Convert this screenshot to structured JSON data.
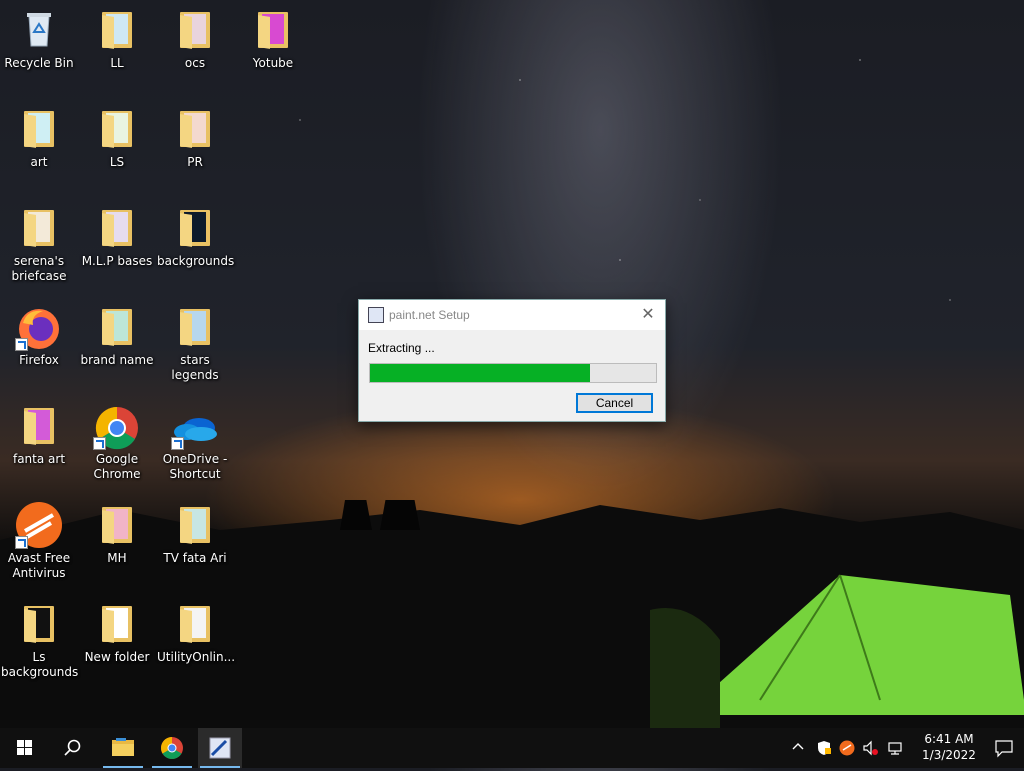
{
  "desktop": {
    "icons": [
      {
        "label": "Recycle Bin",
        "type": "recycle-bin"
      },
      {
        "label": "LL",
        "type": "folder"
      },
      {
        "label": "ocs",
        "type": "folder"
      },
      {
        "label": "Yotube",
        "type": "folder"
      },
      {
        "label": "art",
        "type": "folder"
      },
      {
        "label": "LS",
        "type": "folder"
      },
      {
        "label": "PR",
        "type": "folder"
      },
      {
        "label": "serena's briefcase",
        "type": "folder"
      },
      {
        "label": "M.L.P bases",
        "type": "folder"
      },
      {
        "label": "backgrounds",
        "type": "folder"
      },
      {
        "label": "Firefox",
        "type": "firefox-shortcut"
      },
      {
        "label": "brand name",
        "type": "folder"
      },
      {
        "label": "stars legends",
        "type": "folder"
      },
      {
        "label": "fanta art",
        "type": "folder"
      },
      {
        "label": "Google Chrome",
        "type": "chrome-shortcut"
      },
      {
        "label": "OneDrive - Shortcut",
        "type": "onedrive-shortcut"
      },
      {
        "label": "Avast Free Antivirus",
        "type": "avast-shortcut"
      },
      {
        "label": "MH",
        "type": "folder"
      },
      {
        "label": "TV fata Ari",
        "type": "folder"
      },
      {
        "label": "Ls backgrounds",
        "type": "folder"
      },
      {
        "label": "New folder",
        "type": "folder"
      },
      {
        "label": "UtilityOnlin...",
        "type": "folder"
      }
    ]
  },
  "dialog": {
    "title": "paint.net Setup",
    "status": "Extracting ...",
    "progress_fraction": 0.77,
    "cancel_label": "Cancel",
    "close_glyph": "✕"
  },
  "taskbar": {
    "pinned": [
      "file-explorer-icon",
      "chrome-icon",
      "paint-net-setup-icon"
    ],
    "clock": {
      "time": "6:41 AM",
      "date": "1/3/2022"
    },
    "tray_icons": [
      "chevron-up-icon",
      "security-icon",
      "avast-icon",
      "volume-muted-icon",
      "network-icon"
    ]
  },
  "colors": {
    "progress_fill": "#06b025",
    "taskbar": "#101010",
    "accent": "#0078d7"
  }
}
